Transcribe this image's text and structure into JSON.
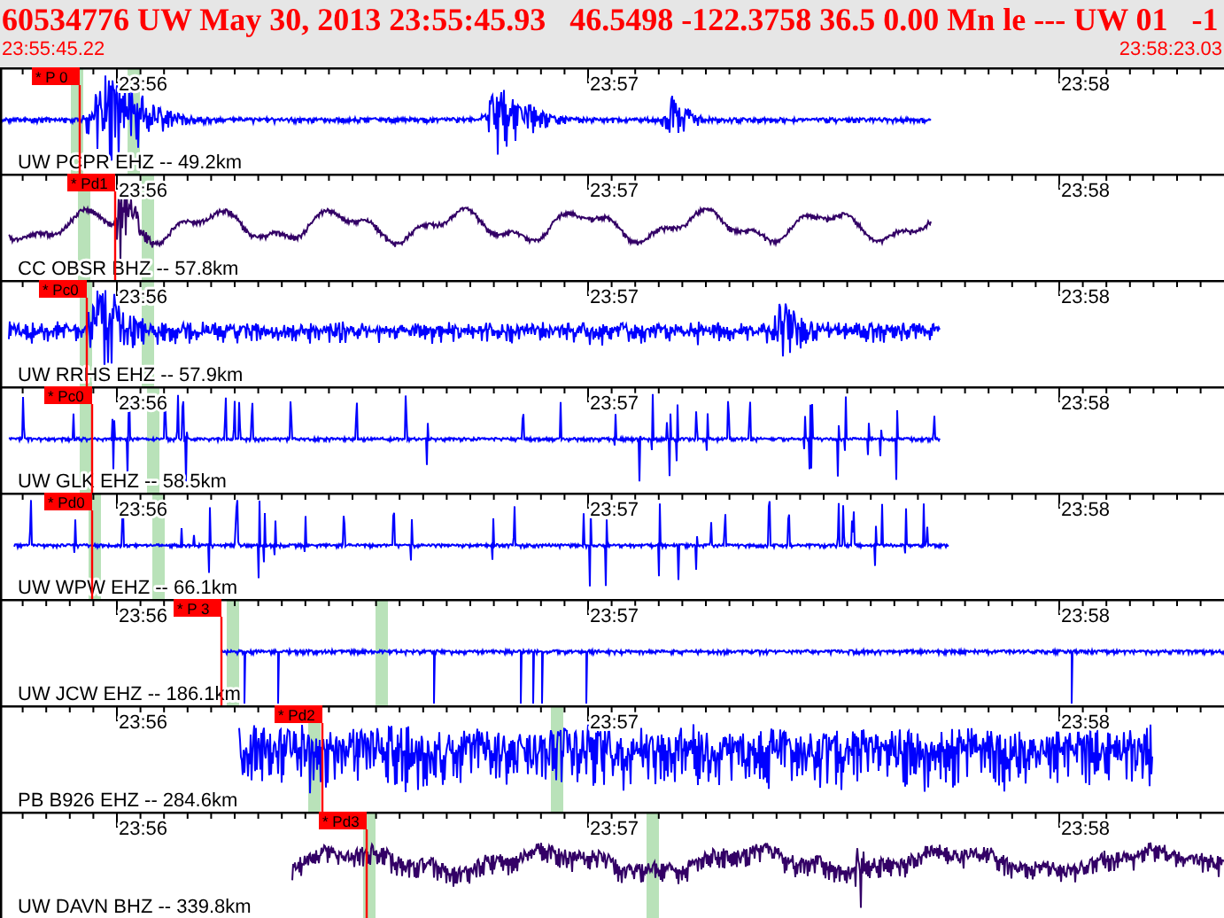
{
  "header": {
    "title": "60534776 UW May 30, 2013 23:55:45.93   46.5498 -122.3758 36.5 0.00 Mn le --- UW 01   -1",
    "start_time": "23:55:45.22",
    "end_time": "23:58:23.03"
  },
  "traces": [
    {
      "station": "UW PCPR EHZ -- 49.2km",
      "pick": "* P 0",
      "kind": "event",
      "color": "#0000ff",
      "time_labels": [
        "23:56",
        "23:57",
        "23:58"
      ]
    },
    {
      "station": "CC OBSR BHZ -- 57.8km",
      "pick": "* Pd1",
      "kind": "longperiod",
      "color": "#330066",
      "time_labels": [
        "23:56",
        "23:57",
        "23:58"
      ]
    },
    {
      "station": "UW RRHS EHZ -- 57.9km",
      "pick": "* Pc0",
      "kind": "noise",
      "color": "#0000ff",
      "time_labels": [
        "23:56",
        "23:57",
        "23:58"
      ]
    },
    {
      "station": "UW GLK EHZ -- 58.5km",
      "pick": "* Pc0",
      "kind": "spikes",
      "color": "#0000ff",
      "time_labels": [
        "23:56",
        "23:57",
        "23:58"
      ]
    },
    {
      "station": "UW WPW EHZ -- 66.1km",
      "pick": "* Pd0",
      "kind": "spikes",
      "color": "#0000ff",
      "time_labels": [
        "23:56",
        "23:57",
        "23:58"
      ]
    },
    {
      "station": "UW JCW EHZ -- 186.1km",
      "pick": "* P 3",
      "kind": "flat",
      "color": "#0000ff",
      "time_labels": [
        "23:56",
        "23:57",
        "23:58"
      ]
    },
    {
      "station": "PB B926 EHZ -- 284.6km",
      "pick": "* Pd2",
      "kind": "heavy",
      "color": "#0000ff",
      "time_labels": [
        "23:56",
        "23:57",
        "23:58"
      ]
    },
    {
      "station": "UW DAVN BHZ -- 339.8km",
      "pick": "* Pd3",
      "kind": "wiggle",
      "color": "#330066",
      "time_labels": [
        "23:56",
        "23:57",
        "23:58"
      ]
    }
  ]
}
